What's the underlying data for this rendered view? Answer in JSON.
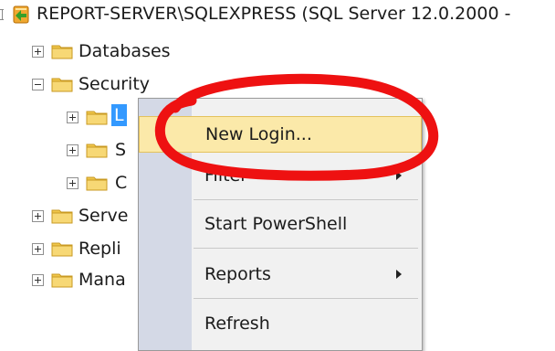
{
  "tree": {
    "server_label": "REPORT-SERVER\\SQLEXPRESS (SQL Server 12.0.2000 -",
    "nodes": [
      {
        "label": "Databases"
      },
      {
        "label": "Security"
      },
      {
        "label": "L"
      },
      {
        "label": "S"
      },
      {
        "label": "C"
      },
      {
        "label": "Serve"
      },
      {
        "label": "Repli"
      },
      {
        "label": "Mana"
      }
    ]
  },
  "context_menu": {
    "items": [
      {
        "label": "New Login..."
      },
      {
        "label": "Filter"
      },
      {
        "label": "Start PowerShell"
      },
      {
        "label": "Reports"
      },
      {
        "label": "Refresh"
      }
    ]
  },
  "colors": {
    "highlight": "#fbe9a9",
    "annotation_circle": "#ee1111",
    "folder": "#f0c64b"
  }
}
